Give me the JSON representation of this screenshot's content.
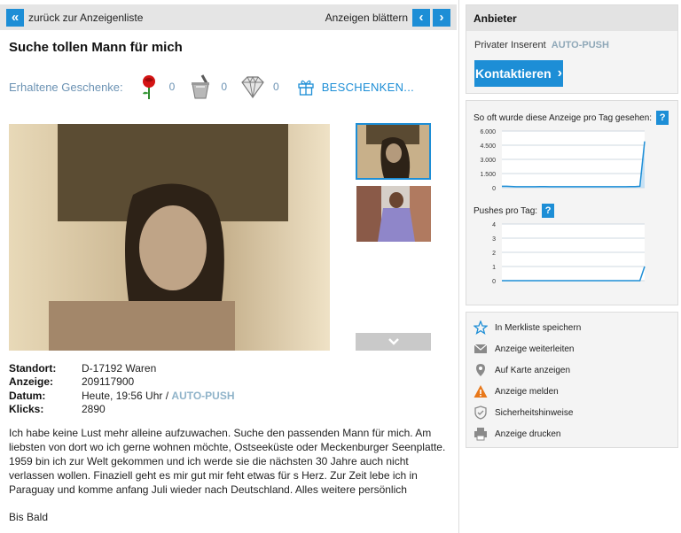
{
  "nav": {
    "back_label": "zurück zur Anzeigenliste",
    "browse_label": "Anzeigen blättern"
  },
  "ad": {
    "title": "Suche tollen Mann für mich",
    "gifts_label": "Erhaltene Geschenke:",
    "gifts": [
      {
        "icon": "rose-icon",
        "count": "0"
      },
      {
        "icon": "champagne-bucket-icon",
        "count": "0"
      },
      {
        "icon": "diamond-icon",
        "count": "0"
      }
    ],
    "gift_action": "BESCHENKEN...",
    "details": {
      "standort_label": "Standort:",
      "standort": "D-17192 Waren",
      "anzeige_label": "Anzeige:",
      "anzeige": "209117900",
      "datum_label": "Datum:",
      "datum": "Heute, 19:56 Uhr /",
      "datum_push": "AUTO-PUSH",
      "klicks_label": "Klicks:",
      "klicks": "2890"
    },
    "description": "Ich habe keine Lust mehr alleine aufzuwachen. Suche den passenden Mann für mich. Am liebsten von dort wo ich gerne wohnen möchte, Ostseeküste oder Meckenburger Seenplatte. 1959 bin ich zur Welt gekommen und ich werde sie die nächsten 30 Jahre auch nicht verlassen wollen. Finaziell geht es mir gut mir feht etwas für s Herz. Zur Zeit lebe ich in Paraguay und komme anfang Juli wieder nach Deutschland. Alles weitere persönlich",
    "signoff": "Bis Bald"
  },
  "provider": {
    "header": "Anbieter",
    "inserent": "Privater Inserent",
    "inserent_push": "AUTO-PUSH",
    "contact_label": "Kontaktieren"
  },
  "stats": {
    "views_title": "So oft wurde diese Anzeige pro Tag gesehen:",
    "pushes_title": "Pushes pro Tag:",
    "help": "?",
    "views_ticks": [
      "6.000",
      "4.500",
      "3.000",
      "1.500",
      "0"
    ],
    "pushes_ticks": [
      "4",
      "3",
      "2",
      "1",
      "0"
    ]
  },
  "chart_data": [
    {
      "type": "area",
      "title": "So oft wurde diese Anzeige pro Tag gesehen:",
      "ylim": [
        0,
        6000
      ],
      "x": [
        1,
        2,
        3,
        4,
        5,
        6,
        7,
        8,
        9,
        10,
        11,
        12,
        13,
        14,
        15,
        16,
        17,
        18,
        19,
        20,
        21,
        22,
        23,
        24,
        25,
        26,
        27,
        28,
        29,
        30,
        31
      ],
      "values": [
        150,
        150,
        130,
        110,
        110,
        110,
        100,
        110,
        120,
        120,
        110,
        110,
        100,
        110,
        110,
        100,
        100,
        110,
        110,
        110,
        100,
        110,
        110,
        100,
        110,
        100,
        110,
        120,
        120,
        150,
        4900
      ],
      "grid": true
    },
    {
      "type": "line",
      "title": "Pushes pro Tag:",
      "ylim": [
        0,
        4
      ],
      "x": [
        1,
        2,
        3,
        4,
        5,
        6,
        7,
        8,
        9,
        10,
        11,
        12,
        13,
        14,
        15,
        16,
        17,
        18,
        19,
        20,
        21,
        22,
        23,
        24,
        25,
        26,
        27,
        28,
        29,
        30,
        31
      ],
      "values": [
        0,
        0,
        0,
        0,
        0,
        0,
        0,
        0,
        0,
        0,
        0,
        0,
        0,
        0,
        0,
        0,
        0,
        0,
        0,
        0,
        0,
        0,
        0,
        0,
        0,
        0,
        0,
        0,
        0,
        0,
        1
      ],
      "grid": true
    }
  ],
  "actions": [
    {
      "icon": "star-icon",
      "label": "In Merkliste speichern"
    },
    {
      "icon": "envelope-icon",
      "label": "Anzeige weiterleiten"
    },
    {
      "icon": "map-pin-icon",
      "label": "Auf Karte anzeigen"
    },
    {
      "icon": "warning-icon",
      "label": "Anzeige melden"
    },
    {
      "icon": "shield-icon",
      "label": "Sicherheitshinweise"
    },
    {
      "icon": "printer-icon",
      "label": "Anzeige drucken"
    }
  ],
  "colors": {
    "accent": "#1d8ed6",
    "warning": "#e8781a",
    "muted_blue": "#6b92b3"
  }
}
